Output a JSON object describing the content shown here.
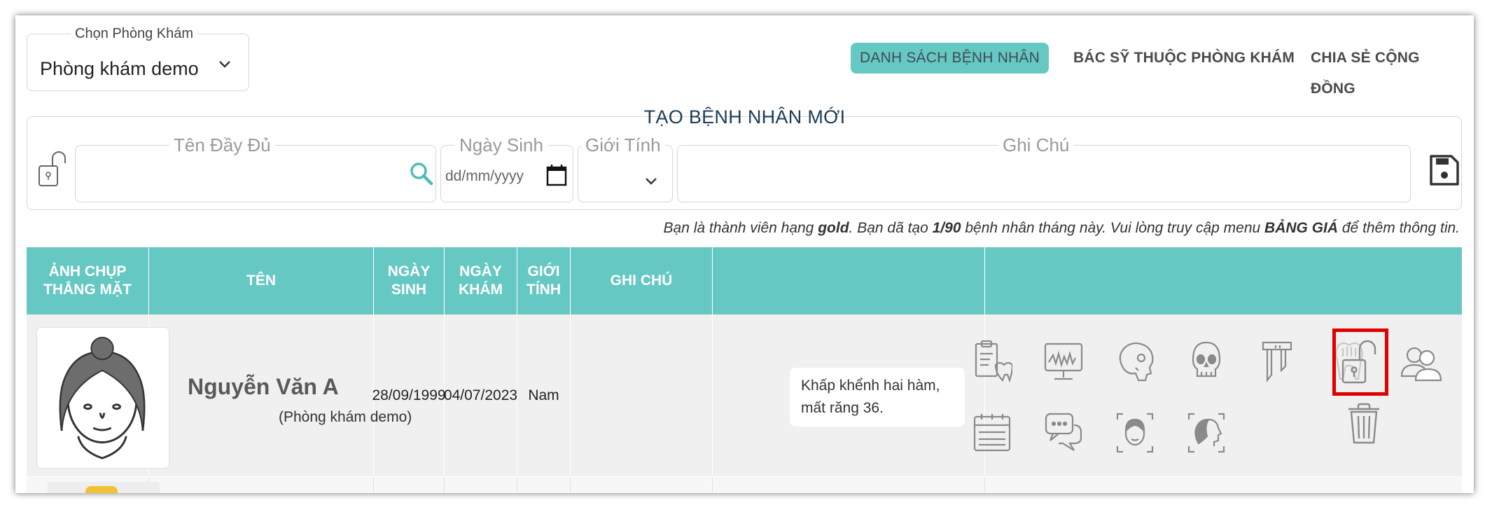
{
  "clinic_select": {
    "legend": "Chọn Phòng Khám",
    "value": "Phòng khám demo"
  },
  "nav": {
    "patients": "DANH SÁCH BỆNH NHÂN",
    "doctors": "BÁC SỸ THUỘC PHÒNG KHÁM",
    "community": "CHIA SẺ CỘNG ĐỒNG",
    "active": "patients"
  },
  "create_form": {
    "title": "TẠO BỆNH NHÂN MỚI",
    "full_name_label": "Tên Đầy Đủ",
    "full_name_value": "",
    "birth_label": "Ngày Sinh",
    "birth_placeholder": "dd/mm/yyyy",
    "gender_label": "Giới Tính",
    "gender_value": "",
    "note_label": "Ghi Chú",
    "note_value": ""
  },
  "notice": {
    "p1": "Bạn là thành viên hạng ",
    "tier": "gold",
    "p2": ".  Bạn dã tạo ",
    "count": "1/90",
    "p3": " bệnh nhân tháng này.  Vui lòng truy cập menu ",
    "menu": "BẢNG GIÁ",
    "p4": " để thêm thông tin."
  },
  "table": {
    "headers": {
      "photo": "ẢNH CHỤP THẲNG MẶT",
      "name": "TÊN",
      "birth": "NGÀY SINH",
      "visit": "NGÀY KHÁM",
      "gender": "GIỚI TÍNH",
      "note": "GHI CHÚ",
      "tools": "",
      "actions": ""
    },
    "rows": [
      {
        "name": "Nguyễn Văn A",
        "clinic": "(Phòng khám demo)",
        "birth": "28/09/1999",
        "visit": "04/07/2023",
        "gender": "Nam",
        "note": "Khấp khểnh hai hàm, mất răng 36."
      }
    ]
  },
  "icons": {
    "tools": [
      "dental-chart-icon",
      "xray-monitor-icon",
      "skull-profile-icon",
      "skull-front-icon",
      "caliper-icon",
      "tooth-icon",
      "calendar-icon",
      "chat-icon",
      "face-scan-icon",
      "head-scan-icon"
    ],
    "actions": [
      "lock-open-icon",
      "share-doctor-icon",
      "trash-icon"
    ]
  },
  "colors": {
    "accent": "#66c8c3",
    "title": "#1d3c57",
    "highlight_box": "#e00000",
    "icon_grey": "#8a8a8a"
  }
}
